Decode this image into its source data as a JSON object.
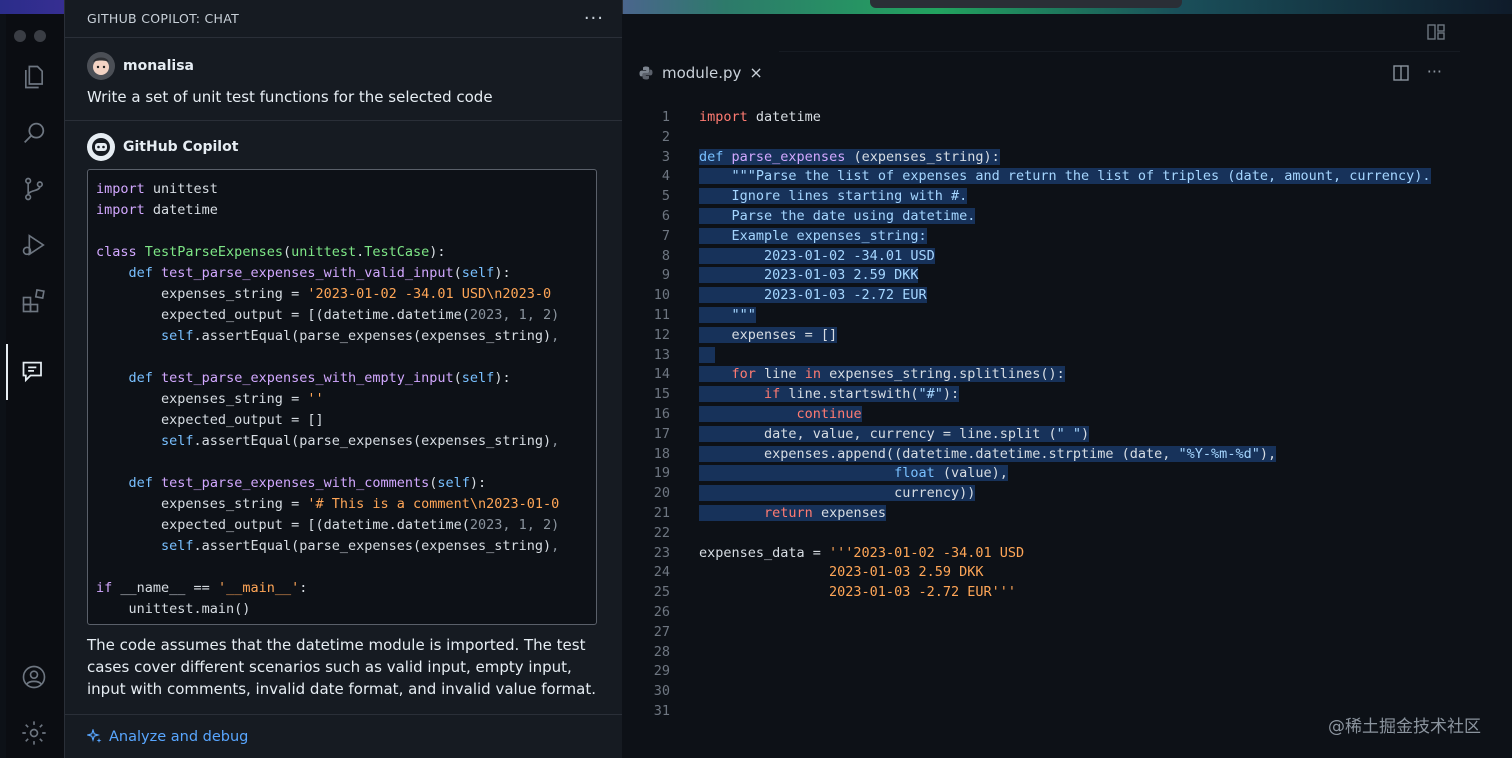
{
  "chat": {
    "title": "GITHUB COPILOT: CHAT",
    "more": "···",
    "user_name": "monalisa",
    "user_message": "Write a set of unit test functions for the selected code",
    "bot_name": "GitHub Copilot",
    "explanation": "The code assumes that the datetime module is imported. The test cases cover different scenarios such as valid input, empty input, input with comments, invalid date format, and invalid value format.",
    "footer_action": "Analyze and debug"
  },
  "editor": {
    "tab_name": "module.py",
    "tab_close": "×",
    "line_numbers": "1\n2\n3\n4\n5\n6\n7\n8\n9\n10\n11\n12\n13\n14\n15\n16\n17\n18\n19\n20\n21\n22\n23\n24\n25\n26\n27\n28\n29\n30\n31"
  },
  "watermark": "@稀土掘金技术社区",
  "icons": [
    "files-icon",
    "search-icon",
    "source-control-icon",
    "run-debug-icon",
    "extensions-icon",
    "chat-icon",
    "account-icon",
    "settings-icon",
    "layout-icon",
    "split-editor-icon",
    "python-file-icon",
    "sparkle-icon"
  ],
  "colors": {
    "accent": "#58a6ff",
    "selection": "#17325a",
    "background": "#0d1117",
    "panel": "#161b22"
  }
}
